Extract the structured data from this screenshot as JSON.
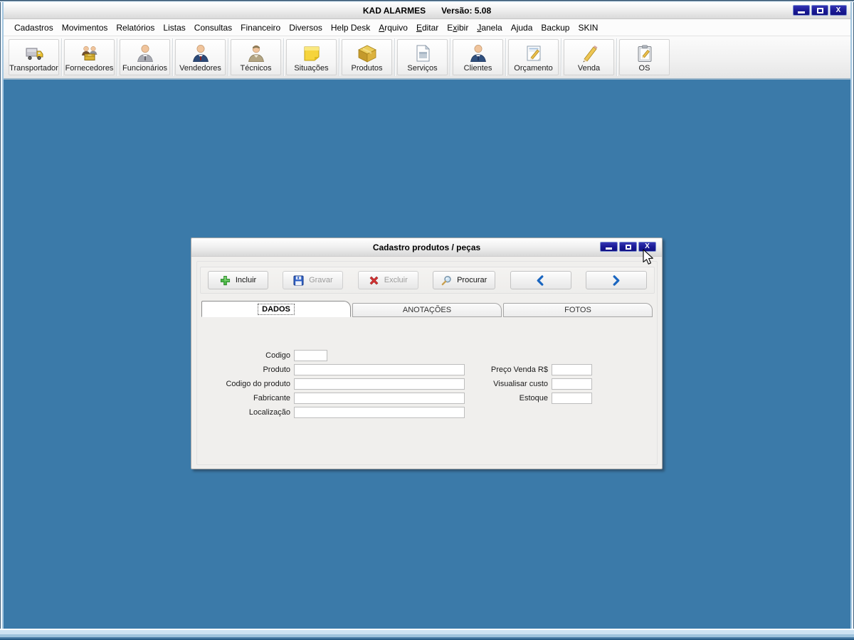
{
  "window": {
    "title_left": "KAD ALARMES",
    "title_right": "Versão: 5.08",
    "controls": {
      "minimize": "minimize",
      "maximize": "maximize",
      "close_glyph": "X"
    }
  },
  "menubar": {
    "items": [
      "Cadastros",
      "Movimentos",
      "Relatórios",
      "Listas",
      "Consultas",
      "Financeiro",
      "Diversos",
      "Help Desk",
      "<u>A</u>rquivo",
      "<u>E</u>ditar",
      "E<u>x</u>ibir",
      "<u>J</u>anela",
      "Ajuda",
      "Backup",
      "SKIN"
    ]
  },
  "toolbar": {
    "buttons": [
      {
        "label": "Transportador",
        "icon": "truck-icon"
      },
      {
        "label": "Fornecedores",
        "icon": "suppliers-icon"
      },
      {
        "label": "Funcionários",
        "icon": "employee-icon"
      },
      {
        "label": "Vendedores",
        "icon": "salesperson-icon"
      },
      {
        "label": "Técnicos",
        "icon": "technician-icon"
      },
      {
        "label": "Situações",
        "icon": "sticky-note-icon"
      },
      {
        "label": "Produtos",
        "icon": "box-icon"
      },
      {
        "label": "Serviços",
        "icon": "document-icon"
      },
      {
        "label": "Clientes",
        "icon": "client-icon"
      },
      {
        "label": "Orçamento",
        "icon": "note-pencil-icon"
      },
      {
        "label": "Venda",
        "icon": "pencil-icon"
      },
      {
        "label": "OS",
        "icon": "clipboard-pencil-icon"
      }
    ]
  },
  "dialog": {
    "title": "Cadastro produtos / peças",
    "toolbar": {
      "buttons": [
        {
          "label": "Incluir",
          "icon": "plus-icon",
          "enabled": true
        },
        {
          "label": "Gravar",
          "icon": "save-icon",
          "enabled": false
        },
        {
          "label": "Excluir",
          "icon": "delete-icon",
          "enabled": false
        },
        {
          "label": "Procurar",
          "icon": "search-icon",
          "enabled": true
        },
        {
          "label": "",
          "icon": "chevron-left-icon",
          "enabled": true
        },
        {
          "label": "",
          "icon": "chevron-right-icon",
          "enabled": true
        }
      ]
    },
    "tabs": [
      {
        "label": "DADOS",
        "active": true
      },
      {
        "label": "ANOTAÇÕES",
        "active": false
      },
      {
        "label": "FOTOS",
        "active": false
      }
    ],
    "form": {
      "left_fields": [
        {
          "label": "Codigo",
          "value": ""
        },
        {
          "label": "Produto",
          "value": ""
        },
        {
          "label": "Codigo do produto",
          "value": ""
        },
        {
          "label": "Fabricante",
          "value": ""
        },
        {
          "label": "Localização",
          "value": ""
        }
      ],
      "right_fields": [
        {
          "label": "Preço Venda R$",
          "value": ""
        },
        {
          "label": "Visualisar custo",
          "value": ""
        },
        {
          "label": "Estoque",
          "value": ""
        }
      ]
    }
  },
  "colors": {
    "desktop_blue": "#3b7aa9",
    "window_button_navy": "#1b1b96",
    "titlebar_silver": "#e9e9e9",
    "dialog_body": "#f0efed",
    "accent_green": "#4db848",
    "accent_red": "#d43434",
    "accent_blue": "#1a66c0"
  }
}
